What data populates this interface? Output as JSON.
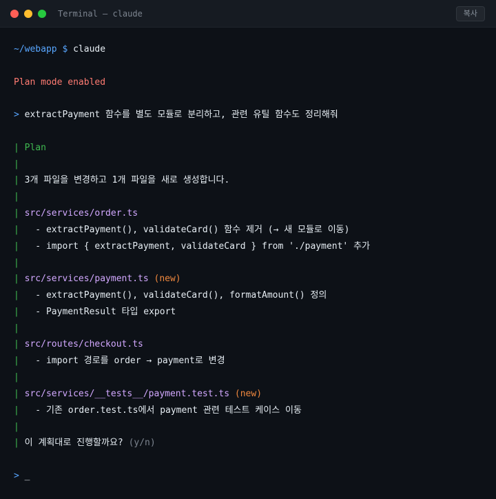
{
  "window": {
    "title": "Terminal — claude",
    "copy_label": "복사"
  },
  "terminal": {
    "prompt_path": "~/webapp $",
    "command": "claude",
    "plan_mode": "Plan mode enabled",
    "user_prompt_marker": ">",
    "user_prompt": "extractPayment 함수를 별도 모듈로 분리하고, 관련 유틸 함수도 정리해줘",
    "bar": "|",
    "plan_title": "Plan",
    "summary": "3개 파일을 변경하고 1개 파일을 새로 생성합니다.",
    "files": [
      {
        "path": "src/services/order.ts",
        "new_tag": "",
        "changes": [
          "  - extractPayment(), validateCard() 함수 제거 (→ 새 모듈로 이동)",
          "  - import { extractPayment, validateCard } from './payment' 추가"
        ]
      },
      {
        "path": "src/services/payment.ts",
        "new_tag": "(new)",
        "changes": [
          "  - extractPayment(), validateCard(), formatAmount() 정의",
          "  - PaymentResult 타입 export"
        ]
      },
      {
        "path": "src/routes/checkout.ts",
        "new_tag": "",
        "changes": [
          "  - import 경로를 order → payment로 변경"
        ]
      },
      {
        "path": "src/services/__tests__/payment.test.ts",
        "new_tag": "(new)",
        "changes": [
          "  - 기존 order.test.ts에서 payment 관련 테스트 케이스 이동"
        ]
      }
    ],
    "confirm_question": "이 계획대로 진행할까요?",
    "confirm_hint": "(y/n)",
    "input_marker": ">",
    "cursor": "_"
  }
}
